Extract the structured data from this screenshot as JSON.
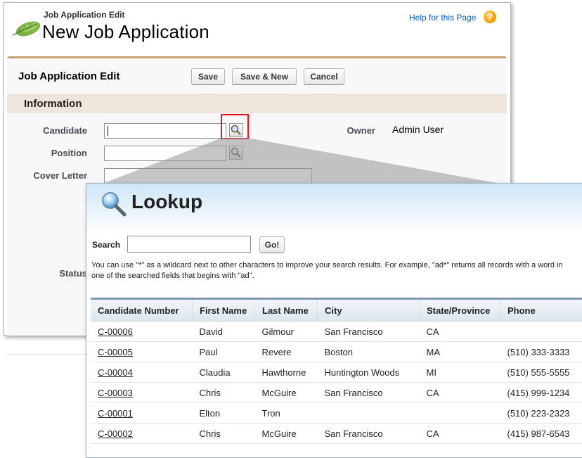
{
  "edit_page": {
    "subtitle": "Job Application Edit",
    "title": "New Job Application",
    "help_link": "Help for this Page",
    "block_title": "Job Application Edit",
    "buttons": {
      "save": "Save",
      "save_new": "Save & New",
      "cancel": "Cancel"
    },
    "section_title": "Information",
    "fields": {
      "candidate_label": "Candidate",
      "position_label": "Position",
      "cover_letter_label": "Cover Letter",
      "status_label": "Status",
      "owner_label": "Owner",
      "owner_value": "Admin User"
    }
  },
  "lookup": {
    "title": "Lookup",
    "search_label": "Search",
    "search_value": "",
    "go_label": "Go!",
    "hint": "You can use \"*\" as a wildcard next to other characters to improve your search results. For example, \"ad*\" returns all records with a word in one of the searched fields that begins with \"ad\".",
    "columns": [
      "Candidate Number",
      "First Name",
      "Last Name",
      "City",
      "State/Province",
      "Phone"
    ],
    "rows": [
      {
        "number": "C-00006",
        "first": "David",
        "last": "Gilmour",
        "city": "San Francisco",
        "state": "CA",
        "phone": ""
      },
      {
        "number": "C-00005",
        "first": "Paul",
        "last": "Revere",
        "city": "Boston",
        "state": "MA",
        "phone": "(510) 333-3333"
      },
      {
        "number": "C-00004",
        "first": "Claudia",
        "last": "Hawthorne",
        "city": "Huntington Woods",
        "state": "MI",
        "phone": "(510) 555-5555"
      },
      {
        "number": "C-00003",
        "first": "Chris",
        "last": "McGuire",
        "city": "San Francisco",
        "state": "CA",
        "phone": "(415) 999-1234"
      },
      {
        "number": "C-00001",
        "first": "Elton",
        "last": "Tron",
        "city": "",
        "state": "",
        "phone": "(510) 223-2323"
      },
      {
        "number": "C-00002",
        "first": "Chris",
        "last": "McGuire",
        "city": "San Francisco",
        "state": "CA",
        "phone": "(415) 987-6543"
      }
    ]
  },
  "colors": {
    "accent_border": "#c49f74",
    "section_bg": "#eee6dc",
    "highlight_red": "#e4161e",
    "link_blue": "#015ba7",
    "lookup_header_blue": "#cfe6f7"
  },
  "icons": [
    "leaf-icon",
    "help-icon",
    "lookup-magnifier-icon",
    "lookup-title-magnifier-icon"
  ]
}
